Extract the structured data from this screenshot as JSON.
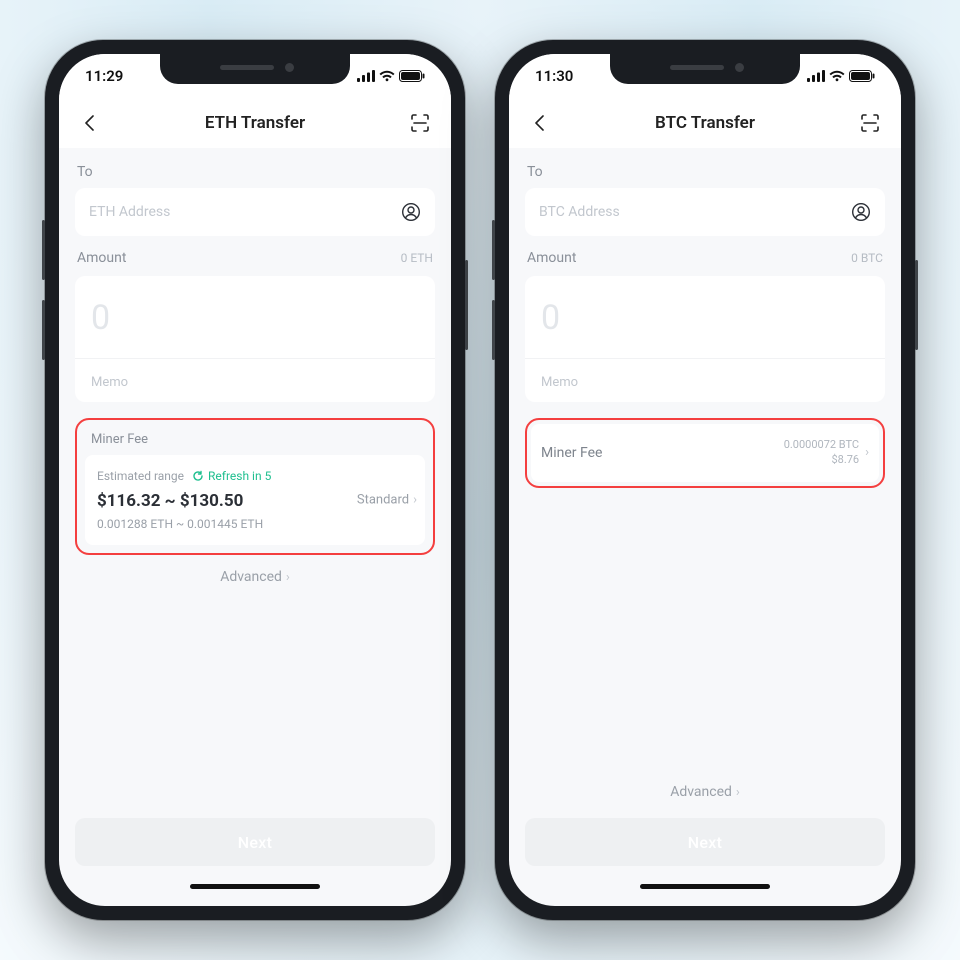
{
  "phoneA": {
    "status": {
      "time": "11:29"
    },
    "nav": {
      "title": "ETH Transfer"
    },
    "to": {
      "label": "To",
      "placeholder": "ETH Address"
    },
    "amount": {
      "label": "Amount",
      "balance": "0 ETH",
      "placeholder": "0"
    },
    "memo": {
      "placeholder": "Memo"
    },
    "miner": {
      "header": "Miner Fee",
      "estimated_label": "Estimated range",
      "refresh_text": "Refresh in 5",
      "price_range": "$116.32 ~ $130.50",
      "eth_range": "0.001288 ETH ~ 0.001445 ETH",
      "mode": "Standard"
    },
    "advanced": "Advanced",
    "next": "Next"
  },
  "phoneB": {
    "status": {
      "time": "11:30"
    },
    "nav": {
      "title": "BTC Transfer"
    },
    "to": {
      "label": "To",
      "placeholder": "BTC Address"
    },
    "amount": {
      "label": "Amount",
      "balance": "0 BTC",
      "placeholder": "0"
    },
    "memo": {
      "placeholder": "Memo"
    },
    "miner": {
      "label": "Miner Fee",
      "fee_btc": "0.0000072 BTC",
      "fee_usd": "$8.76"
    },
    "advanced": "Advanced",
    "next": "Next"
  }
}
